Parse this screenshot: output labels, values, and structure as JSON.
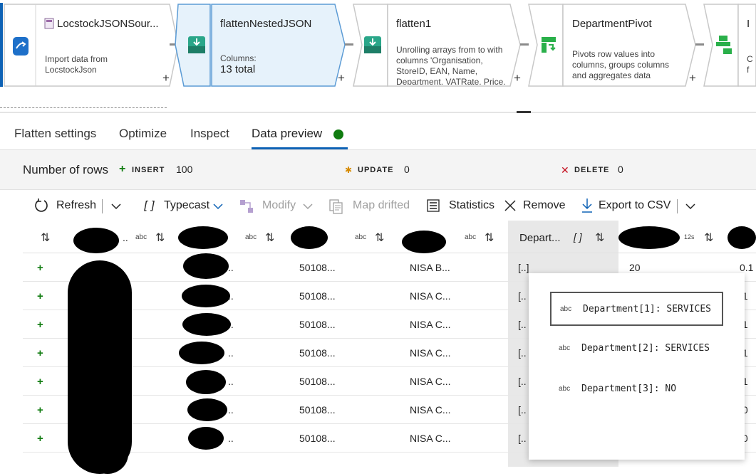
{
  "pipeline": {
    "nodes": [
      {
        "title": "LocstockJSONSour...",
        "desc": "Import data from LocstockJson"
      },
      {
        "title": "flattenNestedJSON",
        "columns_label": "Columns:",
        "columns_value": "13 total"
      },
      {
        "title": "flatten1",
        "desc": "Unrolling arrays from  to with columns 'Organisation, StoreID, EAN, Name, Department, VATRate, Price,"
      },
      {
        "title": "DepartmentPivot",
        "desc": "Pivots row values into columns, groups columns and aggregates data"
      },
      {
        "title": "I",
        "desc": "C f"
      }
    ],
    "plus": "+"
  },
  "tabs": [
    "Flatten settings",
    "Optimize",
    "Inspect",
    "Data preview"
  ],
  "rowbar": {
    "label": "Number of rows",
    "insert_key": "INSERT",
    "insert_val": "100",
    "update_key": "UPDATE",
    "update_val": "0",
    "delete_key": "DELETE",
    "delete_val": "0"
  },
  "toolbar": {
    "refresh": "Refresh",
    "typecast": "Typecast",
    "modify": "Modify",
    "map_drifted": "Map drifted",
    "statistics": "Statistics",
    "remove": "Remove",
    "export": "Export to CSV"
  },
  "grid": {
    "abc": "abc",
    "dept_header": "Depart...",
    "dept_type": "[ ]",
    "num_type": "12s",
    "rows": [
      {
        "c2": "..",
        "c3": "50108...",
        "c4": "NISA B...",
        "c5": "[..]",
        "c6": "20",
        "c7": "0.1"
      },
      {
        "c2": "..",
        "c3": "50108...",
        "c4": "NISA C...",
        "c5": "[..",
        "c6": "",
        "c7": ".1"
      },
      {
        "c2": "..",
        "c3": "50108...",
        "c4": "NISA C...",
        "c5": "[..",
        "c6": "",
        "c7": ".1"
      },
      {
        "c2": "..",
        "c3": "50108...",
        "c4": "NISA C...",
        "c5": "[..",
        "c6": "",
        "c7": ".1"
      },
      {
        "c2": "..",
        "c3": "50108...",
        "c4": "NISA C...",
        "c5": "[..",
        "c6": "",
        "c7": ".1"
      },
      {
        "c2": "..",
        "c3": "50108...",
        "c4": "NISA C...",
        "c5": "[..",
        "c6": "",
        "c7": ".0"
      },
      {
        "c2": "..",
        "c3": "50108...",
        "c4": "NISA C...",
        "c5": "[..",
        "c6": "",
        "c7": ".0"
      }
    ]
  },
  "popup": {
    "abc": "abc",
    "items": [
      "Department[1]: SERVICES",
      "Department[2]: SERVICES",
      "Department[3]: NO"
    ]
  },
  "colors": {
    "accent": "#0e62b5",
    "success": "#107c10",
    "delete": "#c50f1f",
    "update": "#d68a00"
  }
}
